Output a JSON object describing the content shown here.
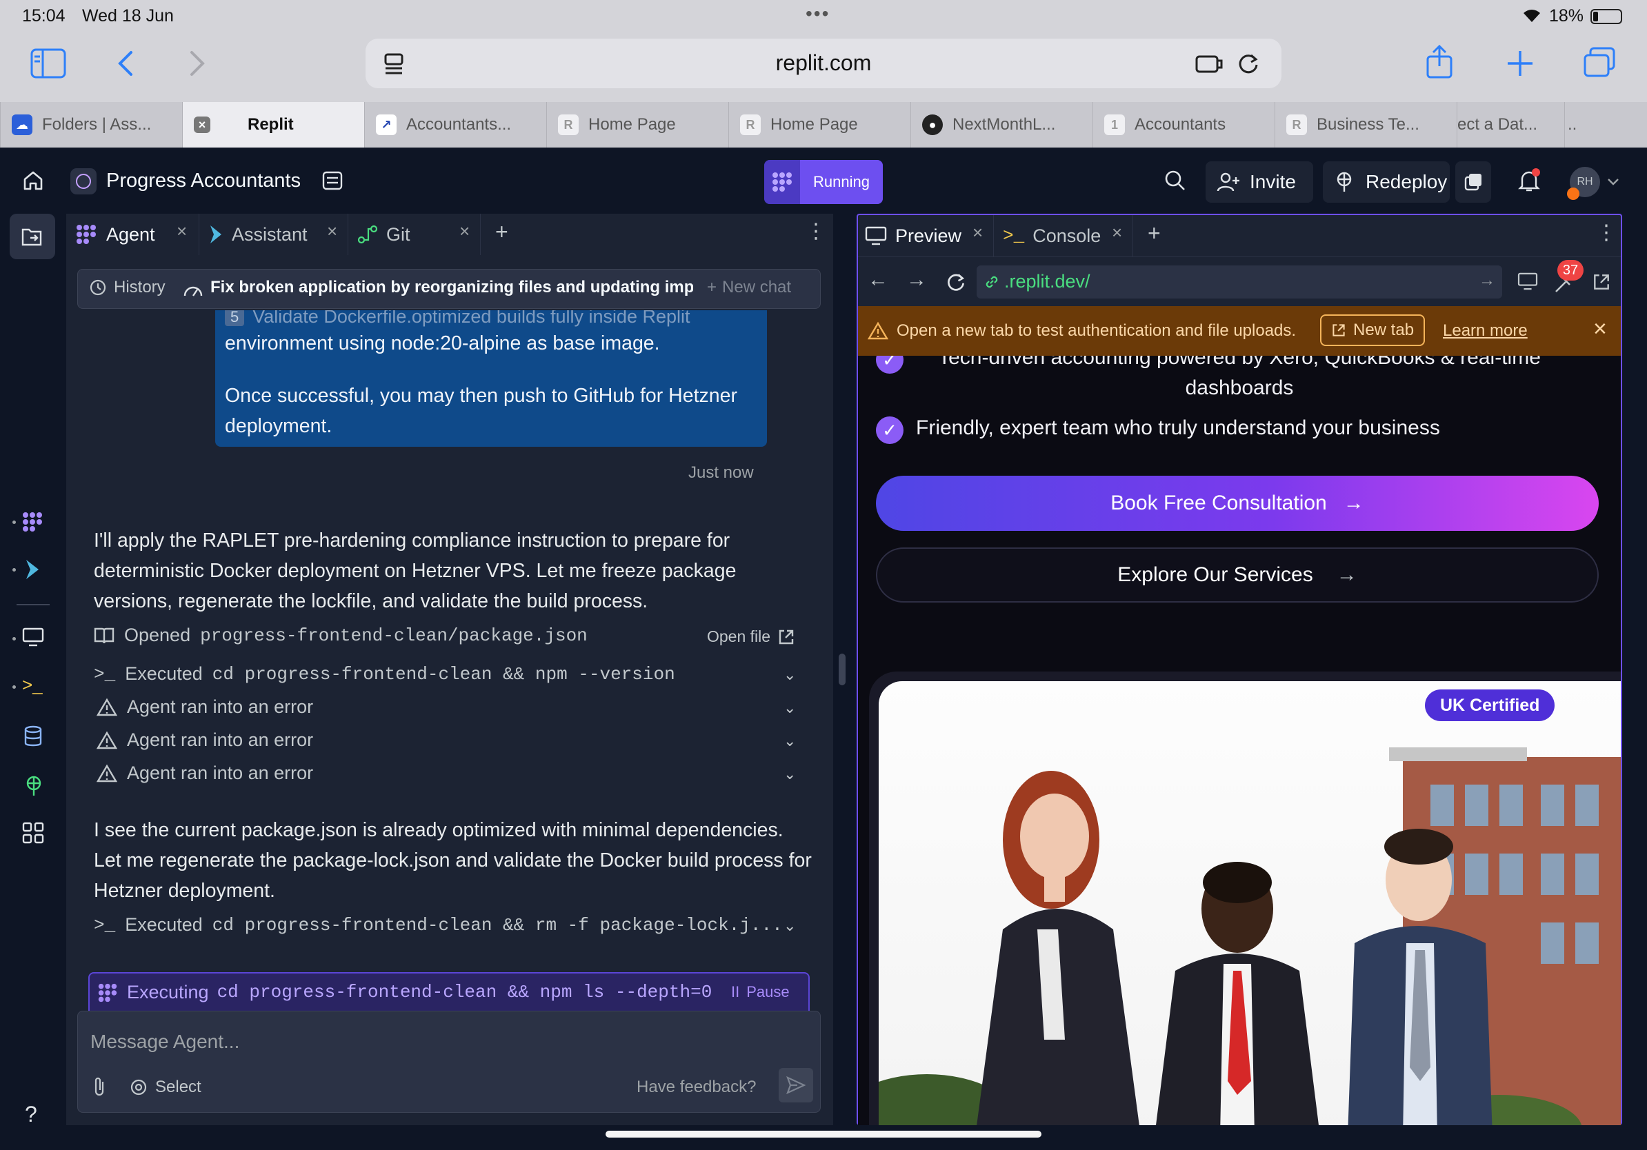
{
  "status_bar": {
    "time": "15:04",
    "date": "Wed 18 Jun",
    "battery": "18%"
  },
  "browser": {
    "url": "replit.com",
    "tabs": [
      {
        "label": "Folders | Ass...",
        "favicon": "cloud"
      },
      {
        "label": "Replit",
        "favicon": "x"
      },
      {
        "label": "Accountants...",
        "favicon": "chart"
      },
      {
        "label": "Home Page",
        "favicon": "R"
      },
      {
        "label": "Home Page",
        "favicon": "R"
      },
      {
        "label": "NextMonthL...",
        "favicon": "github"
      },
      {
        "label": "Accountants",
        "favicon": "1"
      },
      {
        "label": "Business Te...",
        "favicon": "R"
      },
      {
        "label": "ect a Dat...",
        "favicon": ""
      },
      {
        "label": "..",
        "favicon": ""
      }
    ]
  },
  "replit_header": {
    "project_name": "Progress Accountants",
    "run_status": "Running",
    "invite_label": "Invite",
    "redeploy_label": "Redeploy",
    "avatar_initials": "RH",
    "accent_color": "#7c5cff"
  },
  "left_pane": {
    "tabs": [
      {
        "label": "Agent"
      },
      {
        "label": "Assistant"
      },
      {
        "label": "Git"
      }
    ],
    "history_label": "History",
    "chat_title": "Fix broken application by reorganizing files and updating impor...",
    "new_chat_label": "New chat",
    "user_message": {
      "step_num": "5",
      "step_text": "Validate Dockerfile.optimized builds fully inside Replit",
      "line1": "environment using node:20-alpine as base image.",
      "line2": "Once successful, you may then push to GitHub for Hetzner",
      "line3": "deployment.",
      "time": "Just now"
    },
    "agent_para1": [
      "I'll apply the RAPLET pre-hardening compliance instruction to prepare for",
      "deterministic Docker deployment on Hetzner VPS. Let me freeze package",
      "versions, regenerate the lockfile, and validate the build process."
    ],
    "opened_prefix": "Opened",
    "opened_file": "progress-frontend-clean/package.json",
    "open_file_label": "Open file",
    "executed_prefix": "Executed",
    "executed1": "cd progress-frontend-clean && npm --version",
    "errors": [
      "Agent ran into an error",
      "Agent ran into an error",
      "Agent ran into an error"
    ],
    "agent_para2": [
      "I see the current package.json is already optimized with minimal dependencies.",
      "Let me regenerate the package-lock.json and validate the Docker build process for",
      "Hetzner deployment."
    ],
    "executed2": "cd progress-frontend-clean && rm -f package-lock.j...",
    "executing_prefix": "Executing",
    "executing_cmd": "cd progress-frontend-clean && npm ls --depth=0",
    "pause_label": "Pause",
    "composer_placeholder": "Message Agent...",
    "select_label": "Select",
    "feedback_label": "Have feedback?"
  },
  "right_pane": {
    "tabs": [
      {
        "label": "Preview"
      },
      {
        "label": "Console"
      }
    ],
    "preview_url": ".replit.dev/",
    "notification_badge": "37",
    "warning_text": "Open a new tab to test authentication and file uploads.",
    "new_tab_label": "New tab",
    "learn_more_label": "Learn more",
    "site": {
      "feature_partial_line1": "Tech-driven accounting powered by Xero, QuickBooks & real-time",
      "feature_partial_line2": "dashboards",
      "feature2": "Friendly, expert team who truly understand your business",
      "cta_primary": "Book Free Consultation",
      "cta_secondary": "Explore Our Services",
      "badge": "UK Certified",
      "cta_gradient_start": "#4f46e5",
      "cta_gradient_end": "#d946ef"
    }
  },
  "rail": {
    "help_label": "?"
  }
}
